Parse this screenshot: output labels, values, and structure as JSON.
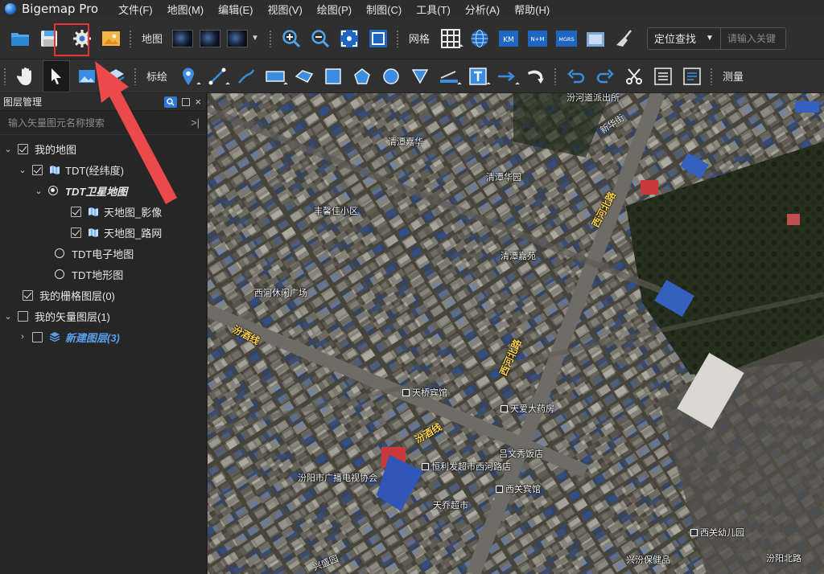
{
  "app": {
    "title": "Bigemap Pro"
  },
  "menu": [
    "文件(F)",
    "地图(M)",
    "编辑(E)",
    "视图(V)",
    "绘图(P)",
    "制图(C)",
    "工具(T)",
    "分析(A)",
    "帮助(H)"
  ],
  "toolbar1": {
    "map_label": "地图",
    "grid_label": "网格",
    "grid_buttons": [
      "KM",
      "N+M",
      "MGRS"
    ],
    "locate_select": "定位查找",
    "locate_placeholder": "请输入关键"
  },
  "toolbar2": {
    "draw_label": "标绘",
    "measure_label": "测量"
  },
  "layer_panel": {
    "title": "图层管理",
    "search_placeholder": "输入矢量图元名称搜索",
    "search_end": ">|",
    "tree": {
      "my_map": "我的地图",
      "tdt": "TDT(经纬度)",
      "tdt_sat": "TDT卫星地图",
      "tdt_img": "天地图_影像",
      "tdt_road": "天地图_路网",
      "tdt_elec": "TDT电子地图",
      "tdt_terrain": "TDT地形图",
      "raster": "我的栅格图层(0)",
      "vector": "我的矢量图层(1)",
      "new_layer": "新建图层(3)"
    }
  },
  "map_labels": {
    "l1": "汾河道派出所",
    "l2": "新华街",
    "l3": "清潭嘉华",
    "l4": "清潭华园",
    "l5": "丰馨佳小区",
    "l6": "清潭嘉苑",
    "l7": "西河休闲广场",
    "l8": "天桥宾馆",
    "l9": "天爱大药房",
    "l10": "吕文秀饭店",
    "l11": "恒利发超市西河路店",
    "l12": "汾阳市广播电视协会",
    "l13": "西关宾馆",
    "l14": "天乔超市",
    "l15": "西关幼儿园",
    "l16": "兴汾保健品",
    "l17": "兴盛园",
    "l18": "汾阳北路",
    "road1": "西河北路",
    "road2": "西河北路",
    "road3": "汾酒线",
    "road4": "汾酒线"
  },
  "colors": {
    "accent": "#2f78d6",
    "annotation": "#e83434",
    "sidebar_bg": "#262626",
    "toolbar_bg": "#2f2f2f"
  }
}
